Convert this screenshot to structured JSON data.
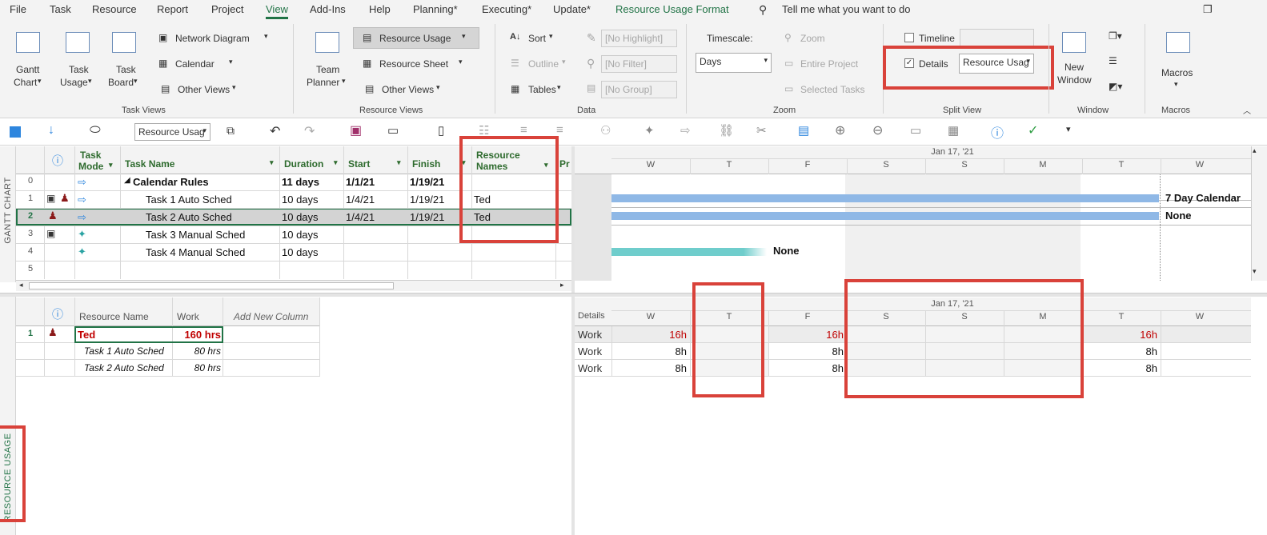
{
  "menu": {
    "items": [
      "File",
      "Task",
      "Resource",
      "Report",
      "Project",
      "View",
      "Add-Ins",
      "Help",
      "Planning*",
      "Executing*",
      "Update*",
      "Resource Usage Format"
    ],
    "active": "View",
    "search_placeholder": "Tell me what you want to do"
  },
  "ribbon": {
    "task_views": {
      "gantt_l1": "Gantt",
      "gantt_l2": "Chart",
      "task_usage_l1": "Task",
      "task_usage_l2": "Usage",
      "task_board_l1": "Task",
      "task_board_l2": "Board",
      "network_diagram": "Network Diagram",
      "calendar": "Calendar",
      "other_views": "Other Views",
      "group_label": "Task Views"
    },
    "resource_views": {
      "team_planner_l1": "Team",
      "team_planner_l2": "Planner",
      "resource_usage": "Resource Usage",
      "resource_sheet": "Resource Sheet",
      "other_views": "Other Views",
      "group_label": "Resource Views"
    },
    "data": {
      "sort": "Sort",
      "outline": "Outline",
      "tables": "Tables",
      "highlight": "[No Highlight]",
      "filter": "[No Filter]",
      "group": "[No Group]",
      "group_label": "Data"
    },
    "zoom": {
      "timescale_label": "Timescale:",
      "timescale_value": "Days",
      "zoom": "Zoom",
      "entire_project": "Entire Project",
      "selected_tasks": "Selected Tasks",
      "group_label": "Zoom"
    },
    "split_view": {
      "timeline": "Timeline",
      "details": "Details",
      "details_value": "Resource Usag",
      "group_label": "Split View"
    },
    "window": {
      "new_window_l1": "New",
      "new_window_l2": "Window",
      "group_label": "Window"
    },
    "macros": {
      "macros": "Macros",
      "group_label": "Macros"
    }
  },
  "qat": {
    "view_combo": "Resource Usag"
  },
  "gantt": {
    "side_label": "GANTT CHART",
    "headers": {
      "task_mode_l1": "Task",
      "task_mode_l2": "Mode",
      "task_name": "Task Name",
      "duration": "Duration",
      "start": "Start",
      "finish": "Finish",
      "resource_l1": "Resource",
      "resource_l2": "Names",
      "pr": "Pr"
    },
    "rows": [
      {
        "id": "0",
        "name": "Calendar Rules",
        "duration": "11 days",
        "start": "1/1/21",
        "finish": "1/19/21",
        "resource": ""
      },
      {
        "id": "1",
        "name": "Task 1 Auto Sched",
        "duration": "10 days",
        "start": "1/4/21",
        "finish": "1/19/21",
        "resource": "Ted"
      },
      {
        "id": "2",
        "name": "Task 2 Auto Sched",
        "duration": "10 days",
        "start": "1/4/21",
        "finish": "1/19/21",
        "resource": "Ted"
      },
      {
        "id": "3",
        "name": "Task 3 Manual Sched",
        "duration": "10 days",
        "start": "",
        "finish": "",
        "resource": ""
      },
      {
        "id": "4",
        "name": "Task 4 Manual Sched",
        "duration": "10 days",
        "start": "",
        "finish": "",
        "resource": ""
      },
      {
        "id": "5",
        "name": "",
        "duration": "",
        "start": "",
        "finish": "",
        "resource": ""
      }
    ],
    "timescale_top": "Jan 17, '21",
    "days": [
      "W",
      "T",
      "F",
      "S",
      "S",
      "M",
      "T",
      "W"
    ],
    "bar_labels": [
      "7 Day Calendar",
      "None",
      "None"
    ]
  },
  "usage": {
    "side_label": "RESOURCE USAGE",
    "headers": {
      "resource_name": "Resource Name",
      "work": "Work",
      "add_column": "Add New Column"
    },
    "rows": [
      {
        "id": "1",
        "name": "Ted",
        "work": "160 hrs"
      },
      {
        "id": "",
        "name": "Task 1 Auto Sched",
        "work": "80 hrs"
      },
      {
        "id": "",
        "name": "Task 2 Auto Sched",
        "work": "80 hrs"
      }
    ],
    "timescale_top": "Jan 17, '21",
    "details_label": "Details",
    "days": [
      "W",
      "T",
      "F",
      "S",
      "S",
      "M",
      "T",
      "W"
    ],
    "detail_rows": [
      {
        "label": "Work",
        "values": [
          "16h",
          "",
          "16h",
          "",
          "",
          "",
          "16h",
          ""
        ]
      },
      {
        "label": "Work",
        "values": [
          "8h",
          "",
          "8h",
          "",
          "",
          "",
          "8h",
          ""
        ]
      },
      {
        "label": "Work",
        "values": [
          "8h",
          "",
          "8h",
          "",
          "",
          "",
          "8h",
          ""
        ]
      }
    ]
  },
  "colors": {
    "accent": "#217346",
    "annotation_red": "#d9423a",
    "bar_blue": "#8fb8e6",
    "bar_teal": "#6fcdcc",
    "resource_red": "#c00000"
  }
}
